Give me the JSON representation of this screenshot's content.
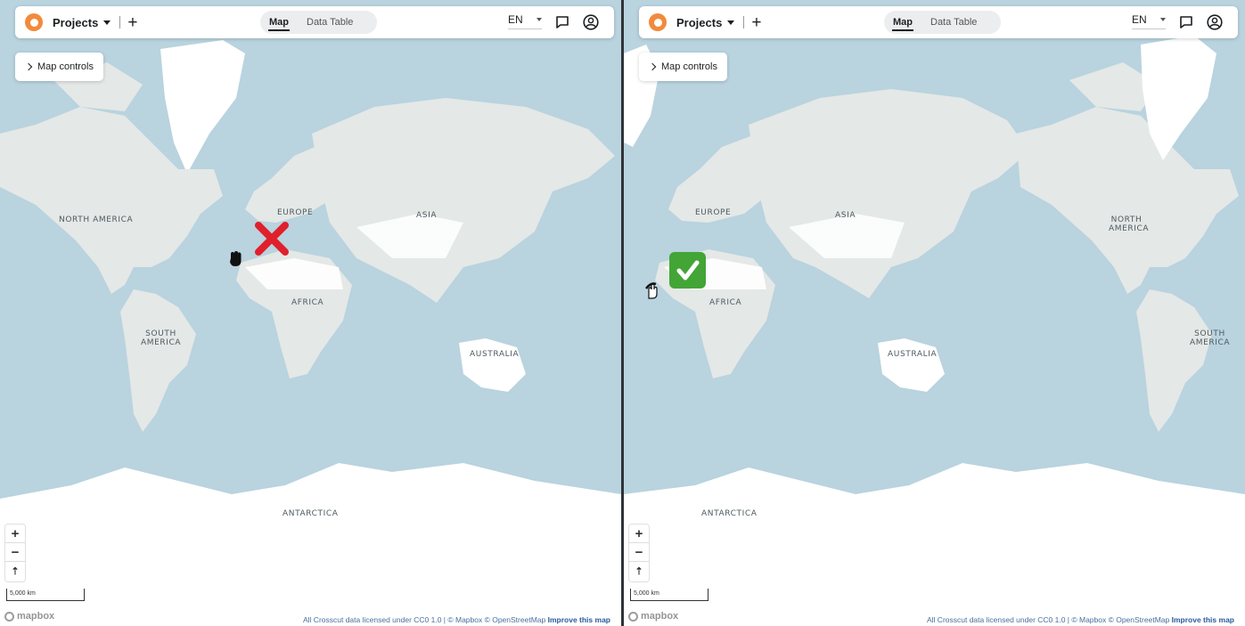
{
  "panels": [
    {
      "id": "left",
      "topbar": {
        "project_menu_label": "Projects",
        "add_label": "+",
        "tabs": [
          {
            "label": "Map",
            "active": true
          },
          {
            "label": "Data Table",
            "active": false
          }
        ],
        "language": "EN"
      },
      "map_controls_label": "Map controls",
      "continent_labels": {
        "north_america": "NORTH AMERICA",
        "south_america": "SOUTH AMERICA",
        "europe": "EUROPE",
        "asia": "ASIA",
        "africa": "AFRICA",
        "australia": "AUSTRALIA",
        "antarctica": "ANTARCTICA"
      },
      "zoom": {
        "in": "+",
        "out": "−",
        "reset": "⇡"
      },
      "scale_label": "5,000 km",
      "mapbox_label": "mapbox",
      "attribution": {
        "text": "All Crosscut data licensed under CC0 1.0 | © Mapbox © OpenStreetMap",
        "improve": "Improve this map"
      },
      "overlay": "red-cross",
      "cursor": "grab-hand"
    },
    {
      "id": "right",
      "topbar": {
        "project_menu_label": "Projects",
        "add_label": "+",
        "tabs": [
          {
            "label": "Map",
            "active": true
          },
          {
            "label": "Data Table",
            "active": false
          }
        ],
        "language": "EN"
      },
      "map_controls_label": "Map controls",
      "continent_labels": {
        "north_america": "NORTH AMERICA",
        "south_america": "SOUTH AMERICA",
        "europe": "EUROPE",
        "asia": "ASIA",
        "africa": "AFRICA",
        "australia": "AUSTRALIA",
        "antarctica": "ANTARCTICA"
      },
      "zoom": {
        "in": "+",
        "out": "−",
        "reset": "⇡"
      },
      "scale_label": "5,000 km",
      "mapbox_label": "mapbox",
      "attribution": {
        "text": "All Crosscut data licensed under CC0 1.0 | © Mapbox © OpenStreetMap",
        "improve": "Improve this map"
      },
      "overlay": "green-check",
      "cursor": "pointer-hand"
    }
  ],
  "colors": {
    "ocean": "#b9d3df",
    "land": "#e4e8e6",
    "ice": "#ffffff",
    "brand": "#f28a3b",
    "cross": "#e0202c",
    "check": "#43a535",
    "link": "#2a5a9c"
  },
  "icons": [
    "crosscut-logo-icon",
    "caret-down-icon",
    "plus-icon",
    "chat-icon",
    "user-circle-icon",
    "chevron-right-icon",
    "zoom-in-icon",
    "zoom-out-icon",
    "compass-icon",
    "mapbox-logo-icon",
    "red-cross-icon",
    "green-check-icon",
    "hand-cursor-icon"
  ]
}
